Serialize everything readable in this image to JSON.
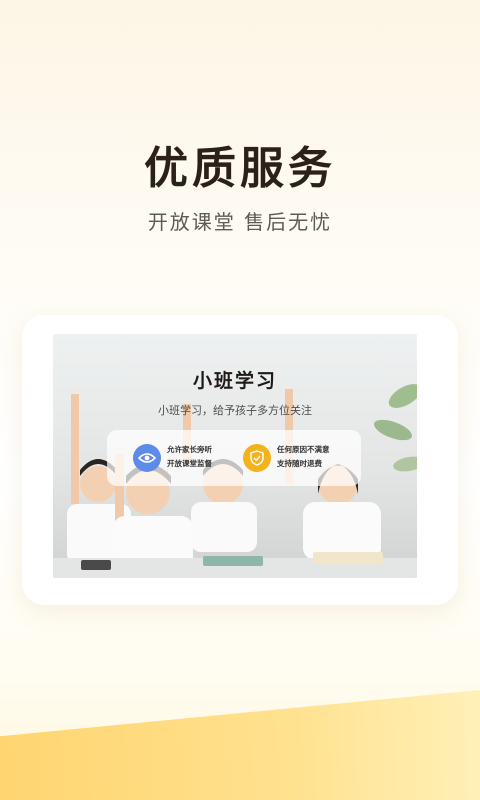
{
  "hero": {
    "title": "优质服务",
    "subtitle": "开放课堂  售后无忧"
  },
  "card": {
    "title": "小班学习",
    "subtitle": "小班学习，给予孩子多方位关注",
    "features": [
      {
        "icon": "eye-icon",
        "line1": "允许家长旁听",
        "line2": "开放课堂监督",
        "color": "#5d8be8"
      },
      {
        "icon": "shield-check-icon",
        "line1": "任何原因不满意",
        "line2": "支持随时退费",
        "color": "#f3b31c"
      }
    ]
  },
  "colors": {
    "accent": "#ffd36a",
    "title": "#2b2118"
  }
}
